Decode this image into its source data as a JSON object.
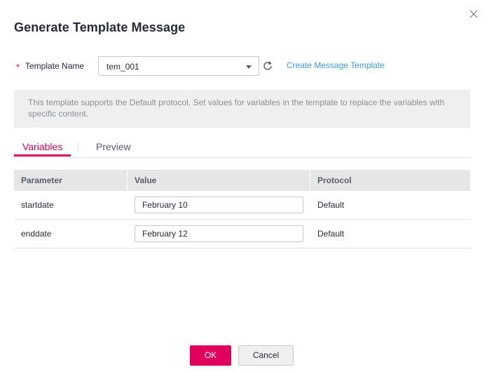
{
  "dialog": {
    "title": "Generate Template Message"
  },
  "form": {
    "required_mark": "*",
    "template_name_label": "Template Name",
    "template_name_value": "tem_001",
    "create_link": "Create Message Template"
  },
  "notice": {
    "text": "This template supports the Default protocol. Set values for variables in the template to replace the variables with specific content."
  },
  "tabs": [
    {
      "label": "Variables",
      "active": true
    },
    {
      "label": "Preview",
      "active": false
    }
  ],
  "table": {
    "headers": [
      "Parameter",
      "Value",
      "Protocol"
    ],
    "rows": [
      {
        "parameter": "startdate",
        "value": "February 10",
        "protocol": "Default"
      },
      {
        "parameter": "enddate",
        "value": "February 12",
        "protocol": "Default"
      }
    ]
  },
  "footer": {
    "ok_label": "OK",
    "cancel_label": "Cancel"
  },
  "colors": {
    "accent": "#e0005c",
    "link": "#3b9be6",
    "notice_bg": "#efefef",
    "header_bg": "#e6e6e6"
  },
  "icons": [
    "close-icon",
    "chevron-down-icon",
    "refresh-icon"
  ]
}
